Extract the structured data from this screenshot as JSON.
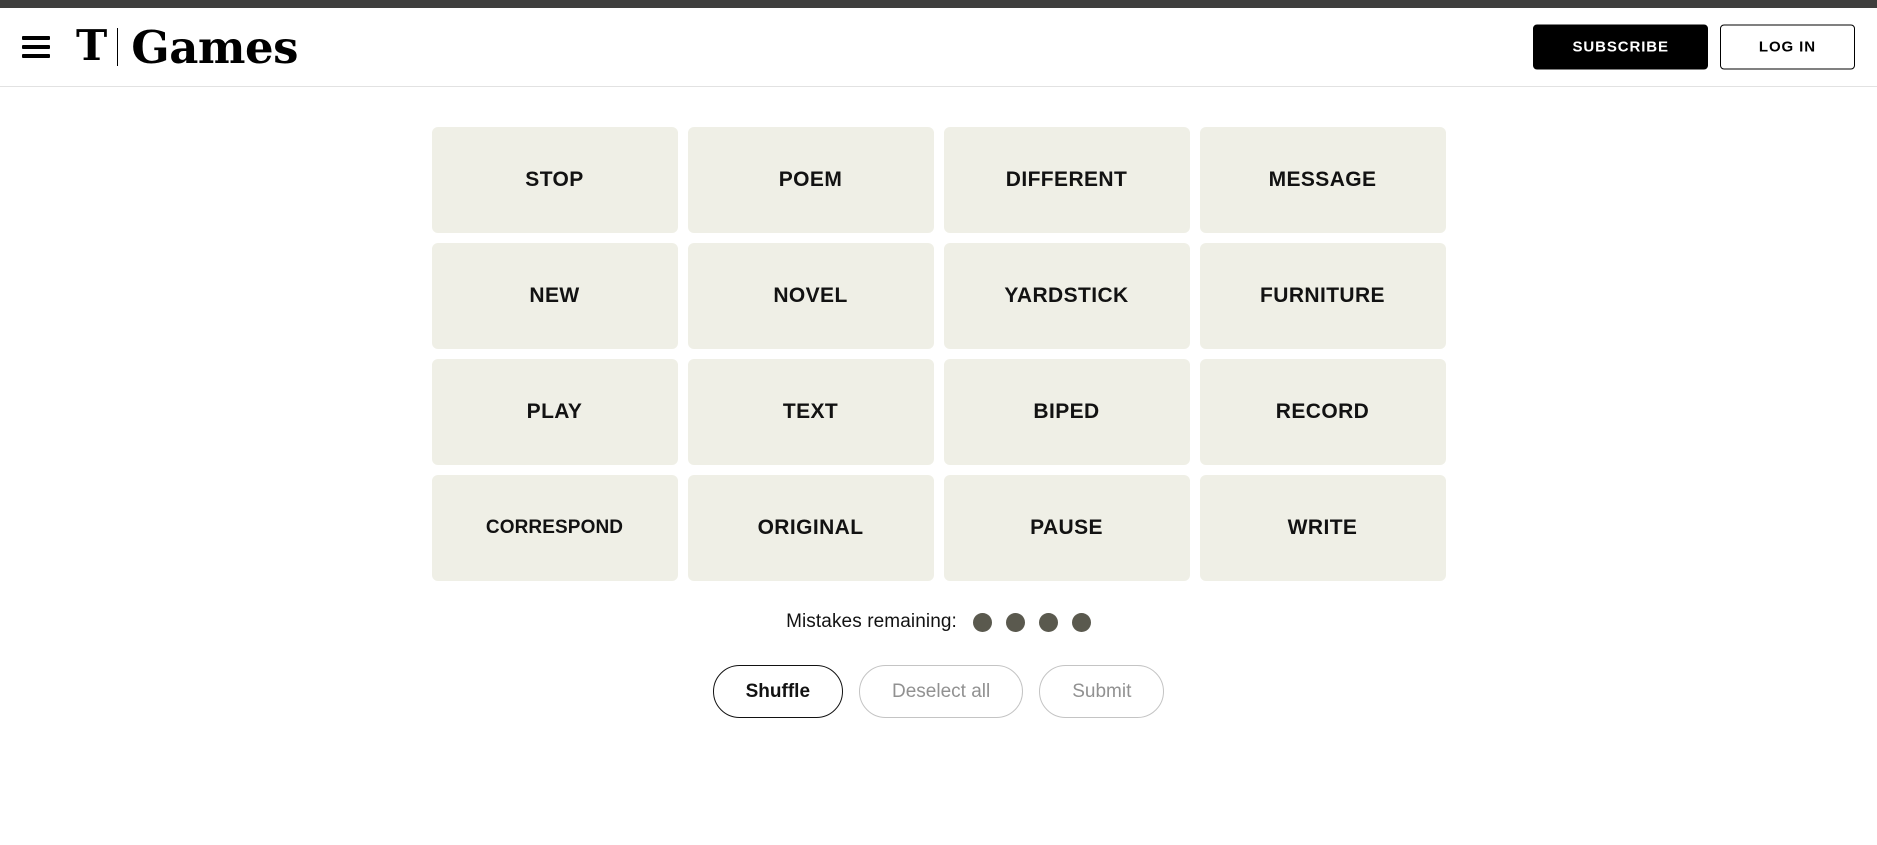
{
  "header": {
    "menu_icon": "hamburger-menu-icon",
    "logo_mark": "T",
    "logo_text": "Games",
    "subscribe_label": "SUBSCRIBE",
    "login_label": "LOG IN"
  },
  "board": {
    "tiles": [
      {
        "word": "STOP",
        "long": false
      },
      {
        "word": "POEM",
        "long": false
      },
      {
        "word": "DIFFERENT",
        "long": false
      },
      {
        "word": "MESSAGE",
        "long": false
      },
      {
        "word": "NEW",
        "long": false
      },
      {
        "word": "NOVEL",
        "long": false
      },
      {
        "word": "YARDSTICK",
        "long": false
      },
      {
        "word": "FURNITURE",
        "long": false
      },
      {
        "word": "PLAY",
        "long": false
      },
      {
        "word": "TEXT",
        "long": false
      },
      {
        "word": "BIPED",
        "long": false
      },
      {
        "word": "RECORD",
        "long": false
      },
      {
        "word": "CORRESPOND",
        "long": true
      },
      {
        "word": "ORIGINAL",
        "long": false
      },
      {
        "word": "PAUSE",
        "long": false
      },
      {
        "word": "WRITE",
        "long": false
      }
    ]
  },
  "mistakes": {
    "label": "Mistakes remaining:",
    "remaining": 4,
    "dot_color": "#5a594e"
  },
  "controls": {
    "shuffle_label": "Shuffle",
    "deselect_label": "Deselect all",
    "submit_label": "Submit",
    "shuffle_enabled": true,
    "deselect_enabled": false,
    "submit_enabled": false
  },
  "colors": {
    "tile_background": "#efefe6",
    "page_background": "#ffffff",
    "top_strip": "#3f3f3e",
    "text": "#121212",
    "disabled_text": "#919191",
    "disabled_border": "#c4c4c4"
  }
}
